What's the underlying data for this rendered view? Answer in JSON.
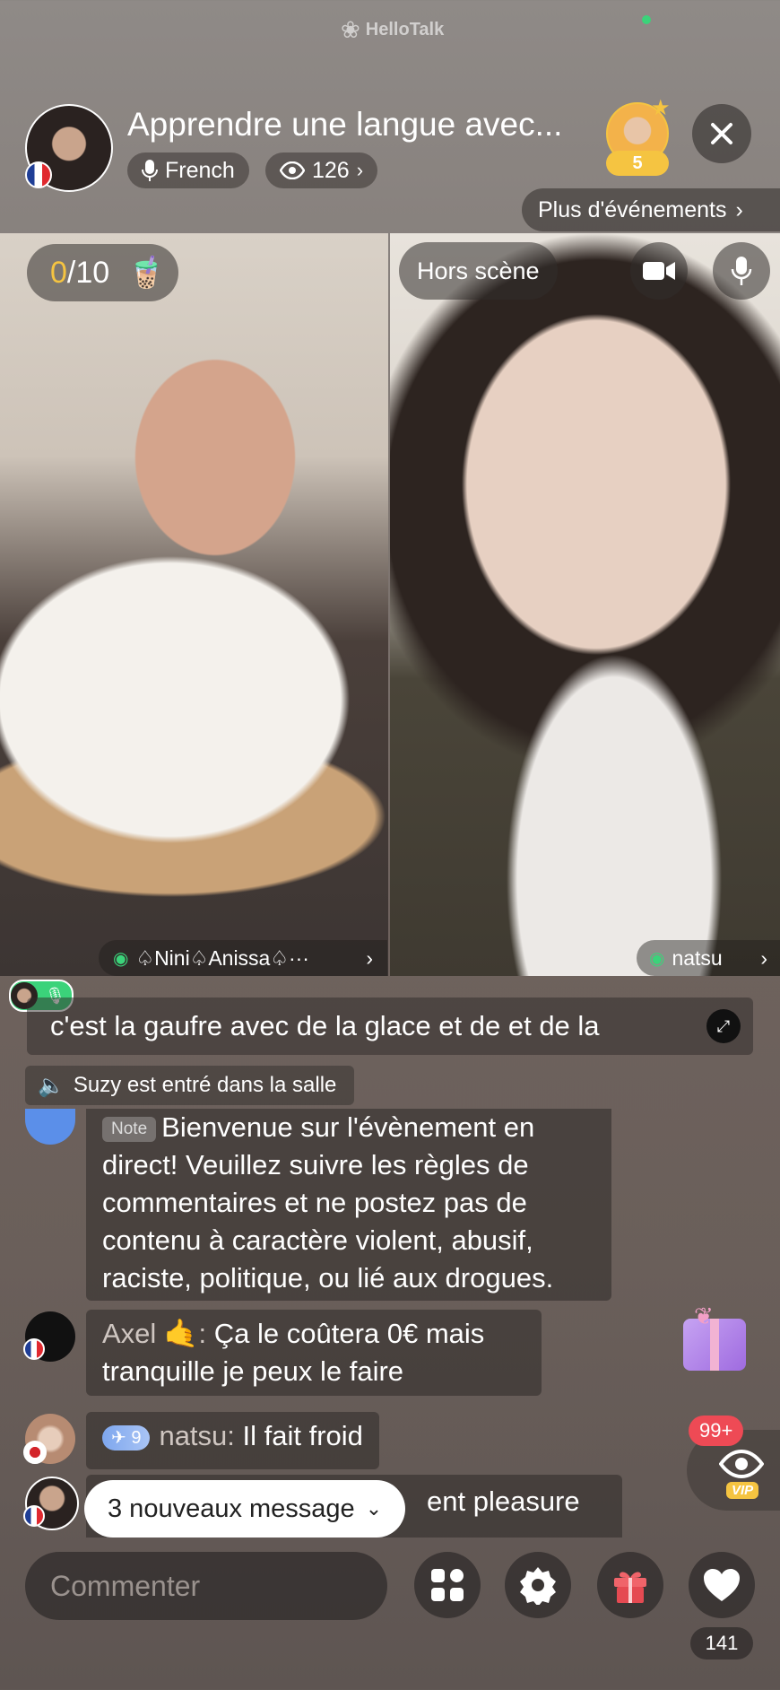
{
  "brand": "HelloTalk",
  "header": {
    "title": "Apprendre une langue avec...",
    "language": "French",
    "viewers": "126",
    "host_level": "5",
    "more_events": "Plus d'événements"
  },
  "left_video": {
    "counter_current": "0",
    "counter_total": "/10",
    "name": "♤Nini♤Anissa♤···"
  },
  "right_video": {
    "offstage": "Hors scène",
    "name": "natsu"
  },
  "caption": "c'est la gaufre avec de la glace et de et de la",
  "join_notice": "Suzy est entré dans la salle",
  "note": {
    "tag": "Note",
    "text": "Bienvenue sur l'évènement en direct! Veuillez suivre les règles de commentaires et ne postez pas de contenu à caractère violent, abusif, raciste, politique, ou lié aux drogues."
  },
  "messages": [
    {
      "user": "Axel 🤙:",
      "text": " Ça le coûtera 0€ mais tranquille je peux le faire"
    },
    {
      "badge": "9",
      "user": "natsu:",
      "text": " Il fait froid"
    },
    {
      "partial": "ent pleasure"
    }
  ],
  "new_messages": "3 nouveaux message",
  "gift_badge": "99+",
  "vip": "VIP",
  "comment_placeholder": "Commenter",
  "likes": "141",
  "colors": {
    "accent_yellow": "#f5c441",
    "green": "#3bd37a",
    "red_badge": "#ee4a55"
  }
}
